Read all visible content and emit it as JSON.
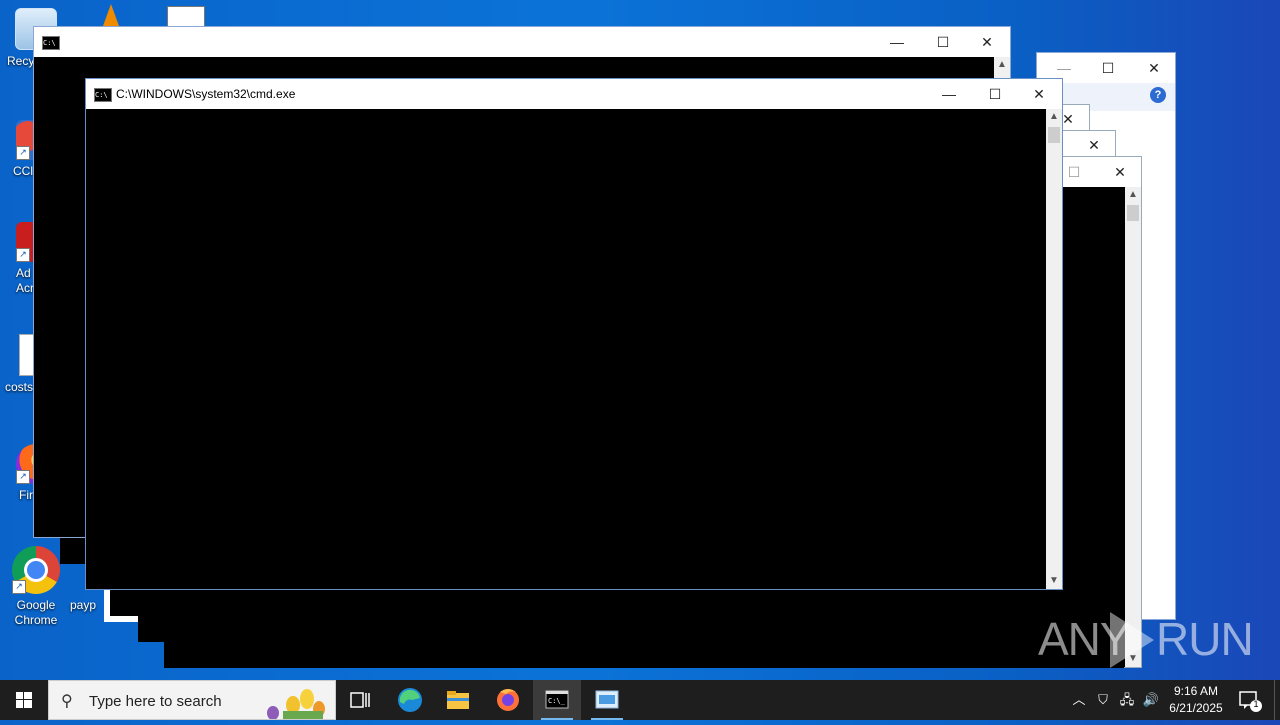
{
  "desktop": {
    "icons": [
      {
        "label": "Recy"
      },
      {
        "label": "CCl"
      },
      {
        "label": "Ad Acr"
      },
      {
        "label": "costs"
      },
      {
        "label": "Fir"
      },
      {
        "label": "Google Chrome"
      },
      {
        "label": "payp"
      }
    ],
    "watermark": {
      "left": "ANY",
      "right": "RUN"
    }
  },
  "windows": {
    "main_cmd": {
      "title": "C:\\WINDOWS\\system32\\cmd.exe"
    },
    "cmd_icon_text": "C:\\"
  },
  "taskbar": {
    "search_placeholder": "Type here to search",
    "clock_time": "9:16 AM",
    "clock_date": "6/21/2025",
    "notification_count": "1"
  },
  "colors": {
    "desktop": "#0b6fd6",
    "taskbar": "#1e1e1e",
    "accent": "#76b9ed"
  }
}
